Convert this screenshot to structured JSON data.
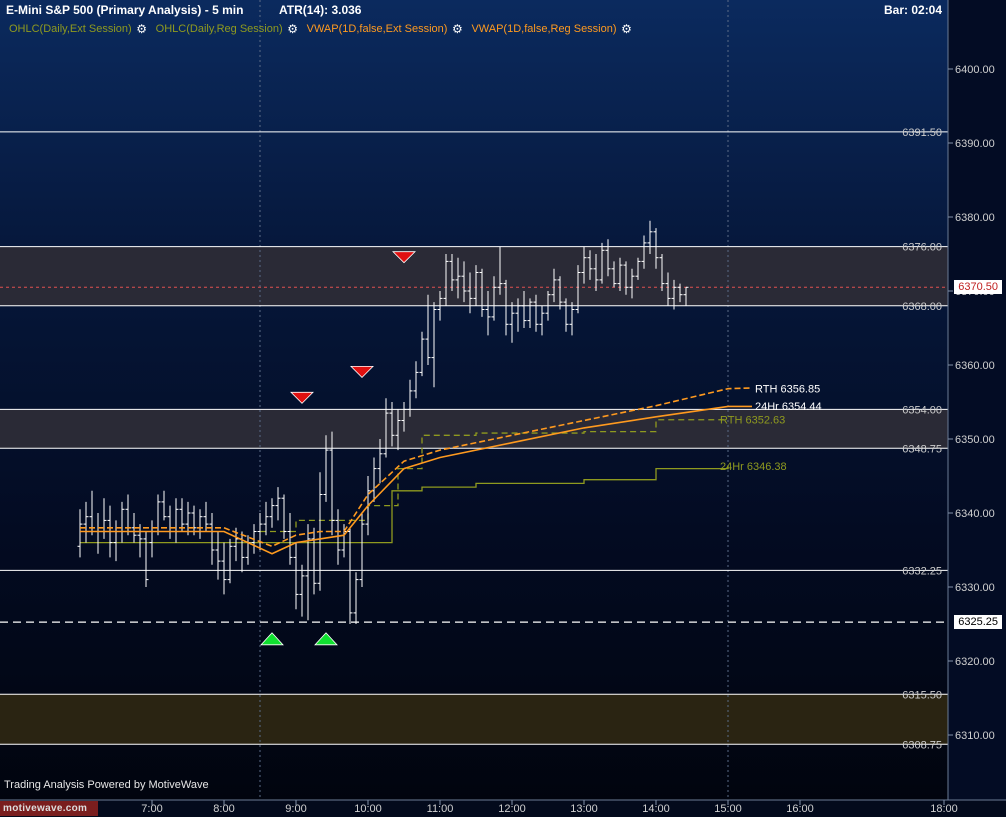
{
  "header": {
    "title": "E-Mini S&P 500 (Primary Analysis) - 5 min",
    "atr": "ATR(14): 3.036",
    "bar_timer": "Bar: 02:04"
  },
  "legend": [
    {
      "label": "OHLC(Daily,Ext Session)",
      "color": "#8f9a1f"
    },
    {
      "label": "OHLC(Daily,Reg Session)",
      "color": "#8f9a1f"
    },
    {
      "label": "VWAP(1D,false,Ext Session)",
      "color": "#ff9a1f"
    },
    {
      "label": "VWAP(1D,false,Reg Session)",
      "color": "#ff9a1f"
    }
  ],
  "icons": {
    "settings": "gear-icon"
  },
  "footer": {
    "powered_by": "Trading Analysis Powered by MotiveWave",
    "logo": "motivewave.com"
  },
  "current_price": {
    "label": "6370.50",
    "value": 6370.5,
    "color": "#ff9a9a"
  },
  "marked_price": {
    "label": "6325.25",
    "value": 6325.25
  },
  "chart_data": {
    "type": "candlestick",
    "title": "E-Mini S&P 500 (Primary Analysis) - 5 min",
    "ylim": [
      6304,
      6406
    ],
    "y_ticks": [
      {
        "label": "6400.00",
        "value": 6400
      },
      {
        "label": "6390.00",
        "value": 6390
      },
      {
        "label": "6380.00",
        "value": 6380
      },
      {
        "label": "6370.00",
        "value": 6370
      },
      {
        "label": "6360.00",
        "value": 6360
      },
      {
        "label": "6350.00",
        "value": 6350
      },
      {
        "label": "6340.00",
        "value": 6340
      },
      {
        "label": "6330.00",
        "value": 6330
      },
      {
        "label": "6320.00",
        "value": 6320
      },
      {
        "label": "6310.00",
        "value": 6310
      }
    ],
    "x_ticks": [
      "7:00",
      "8:00",
      "9:00",
      "10:00",
      "11:00",
      "12:00",
      "13:00",
      "14:00",
      "15:00",
      "16:00",
      "18:00"
    ],
    "session_separators": [
      "8:30",
      "15:00"
    ],
    "levels": [
      {
        "label": "6391.50",
        "value": 6391.5
      },
      {
        "label": "6376.00",
        "value": 6376
      },
      {
        "label": "6368.00",
        "value": 6368
      },
      {
        "label": "6354.00",
        "value": 6354
      },
      {
        "label": "6348.75",
        "value": 6348.75
      },
      {
        "label": "6332.25",
        "value": 6332.25
      },
      {
        "label": "6315.50",
        "value": 6315.5
      },
      {
        "label": "6308.75",
        "value": 6308.75
      }
    ],
    "zones": [
      {
        "from": 6368,
        "to": 6376,
        "color": "#2a2a36"
      },
      {
        "from": 6348.75,
        "to": 6354,
        "color": "#2a2a36"
      },
      {
        "from": 6308.75,
        "to": 6315.5,
        "color": "#2a2412"
      }
    ],
    "annotations": [
      {
        "label": "RTH 6356.85",
        "value": 6356.85,
        "color": "#ffffff"
      },
      {
        "label": "24Hr 6354.44",
        "value": 6354.44,
        "color": "#ffffff"
      },
      {
        "label": "RTH 6352.63",
        "value": 6352.63,
        "color": "#8f9a1f"
      },
      {
        "label": "24Hr 6346.38",
        "value": 6346.38,
        "color": "#8f9a1f"
      }
    ],
    "signals": [
      {
        "type": "sell",
        "time": "9:05",
        "price": 6355.5
      },
      {
        "type": "sell",
        "time": "9:55",
        "price": 6359.0
      },
      {
        "type": "sell",
        "time": "10:30",
        "price": 6374.5
      },
      {
        "type": "buy",
        "time": "8:40",
        "price": 6323.0
      },
      {
        "type": "buy",
        "time": "9:25",
        "price": 6323.0
      }
    ],
    "candles_start": "6:00",
    "candle_interval_minutes": 5,
    "candles": [
      [
        6335.5,
        6340.5,
        6334.0,
        6338.5
      ],
      [
        6338.5,
        6341.5,
        6336.0,
        6339.5
      ],
      [
        6339.5,
        6343.0,
        6337.0,
        6337.5
      ],
      [
        6337.5,
        6340.0,
        6334.5,
        6338.0
      ],
      [
        6338.0,
        6342.0,
        6336.5,
        6339.0
      ],
      [
        6339.0,
        6341.0,
        6334.0,
        6336.0
      ],
      [
        6336.0,
        6339.0,
        6333.5,
        6337.5
      ],
      [
        6337.5,
        6341.5,
        6336.0,
        6340.5
      ],
      [
        6340.5,
        6342.5,
        6337.0,
        6338.0
      ],
      [
        6338.0,
        6340.0,
        6336.0,
        6337.0
      ],
      [
        6337.0,
        6338.5,
        6334.0,
        6336.5
      ],
      [
        6336.5,
        6337.5,
        6330.0,
        6331.0
      ],
      [
        6336.0,
        6339.0,
        6334.0,
        6338.0
      ],
      [
        6338.0,
        6342.5,
        6337.0,
        6341.5
      ],
      [
        6341.5,
        6343.0,
        6339.0,
        6339.5
      ],
      [
        6339.5,
        6341.0,
        6336.5,
        6337.5
      ],
      [
        6337.5,
        6342.0,
        6336.0,
        6340.5
      ],
      [
        6340.5,
        6342.0,
        6337.5,
        6338.5
      ],
      [
        6338.5,
        6341.5,
        6337.0,
        6340.0
      ],
      [
        6340.0,
        6341.0,
        6337.0,
        6338.0
      ],
      [
        6338.0,
        6340.5,
        6336.5,
        6339.5
      ],
      [
        6339.5,
        6341.5,
        6337.5,
        6338.5
      ],
      [
        6338.5,
        6340.0,
        6333.0,
        6335.0
      ],
      [
        6335.0,
        6337.5,
        6331.0,
        6333.5
      ],
      [
        6333.5,
        6336.0,
        6329.0,
        6331.0
      ],
      [
        6331.0,
        6336.5,
        6330.5,
        6335.5
      ],
      [
        6335.5,
        6338.0,
        6333.5,
        6336.5
      ],
      [
        6336.5,
        6337.5,
        6332.0,
        6334.0
      ],
      [
        6334.0,
        6337.0,
        6333.0,
        6336.0
      ],
      [
        6336.0,
        6338.5,
        6334.5,
        6337.5
      ],
      [
        6337.5,
        6340.0,
        6335.0,
        6338.5
      ],
      [
        6338.5,
        6341.5,
        6337.0,
        6339.5
      ],
      [
        6339.5,
        6342.0,
        6338.0,
        6341.0
      ],
      [
        6341.0,
        6343.5,
        6339.0,
        6342.0
      ],
      [
        6342.0,
        6342.5,
        6336.5,
        6337.5
      ],
      [
        6337.5,
        6340.0,
        6333.0,
        6334.0
      ],
      [
        6334.0,
        6336.0,
        6327.0,
        6329.0
      ],
      [
        6329.0,
        6333.0,
        6326.0,
        6331.5
      ],
      [
        6331.5,
        6338.5,
        6325.5,
        6336.5
      ],
      [
        6336.5,
        6338.0,
        6329.0,
        6330.5
      ],
      [
        6330.5,
        6345.5,
        6329.5,
        6342.5
      ],
      [
        6342.5,
        6350.5,
        6341.5,
        6348.5
      ],
      [
        6348.5,
        6351.0,
        6337.0,
        6339.0
      ],
      [
        6339.0,
        6340.5,
        6333.0,
        6335.0
      ],
      [
        6335.0,
        6338.5,
        6334.0,
        6337.5
      ],
      [
        6337.5,
        6338.0,
        6325.0,
        6326.5
      ],
      [
        6326.5,
        6332.0,
        6325.0,
        6331.0
      ],
      [
        6331.0,
        6340.0,
        6330.0,
        6338.5
      ],
      [
        6338.5,
        6345.0,
        6337.0,
        6343.0
      ],
      [
        6343.0,
        6347.5,
        6341.5,
        6346.0
      ],
      [
        6346.0,
        6350.0,
        6344.0,
        6348.0
      ],
      [
        6348.0,
        6355.5,
        6347.5,
        6353.5
      ],
      [
        6353.5,
        6355.0,
        6349.0,
        6350.5
      ],
      [
        6350.5,
        6354.0,
        6348.5,
        6352.5
      ],
      [
        6352.5,
        6355.0,
        6351.0,
        6354.0
      ],
      [
        6354.0,
        6358.0,
        6353.0,
        6356.5
      ],
      [
        6356.5,
        6360.5,
        6355.5,
        6359.0
      ],
      [
        6359.0,
        6364.5,
        6358.5,
        6363.5
      ],
      [
        6363.5,
        6369.5,
        6360.0,
        6361.0
      ],
      [
        6361.0,
        6368.5,
        6357.0,
        6367.5
      ],
      [
        6367.5,
        6370.0,
        6366.0,
        6369.0
      ],
      [
        6369.0,
        6375.0,
        6368.0,
        6374.0
      ],
      [
        6374.0,
        6375.0,
        6370.0,
        6371.5
      ],
      [
        6371.5,
        6374.5,
        6369.0,
        6372.0
      ],
      [
        6372.0,
        6374.0,
        6368.5,
        6370.0
      ],
      [
        6370.0,
        6372.5,
        6367.0,
        6369.0
      ],
      [
        6369.0,
        6373.5,
        6368.0,
        6372.5
      ],
      [
        6372.5,
        6373.0,
        6366.5,
        6367.5
      ],
      [
        6367.5,
        6370.0,
        6364.0,
        6366.5
      ],
      [
        6366.5,
        6372.0,
        6366.0,
        6370.5
      ],
      [
        6370.5,
        6376.0,
        6369.5,
        6371.0
      ],
      [
        6371.0,
        6371.5,
        6364.0,
        6365.5
      ],
      [
        6365.5,
        6368.5,
        6363.0,
        6367.0
      ],
      [
        6367.0,
        6369.0,
        6364.5,
        6368.0
      ],
      [
        6368.0,
        6370.0,
        6365.0,
        6366.0
      ],
      [
        6366.0,
        6369.0,
        6365.0,
        6368.5
      ],
      [
        6368.5,
        6369.5,
        6364.5,
        6365.5
      ],
      [
        6365.5,
        6368.0,
        6364.0,
        6367.0
      ],
      [
        6367.0,
        6370.0,
        6366.0,
        6369.5
      ],
      [
        6369.5,
        6373.0,
        6368.5,
        6371.5
      ],
      [
        6371.5,
        6372.0,
        6367.5,
        6368.5
      ],
      [
        6368.5,
        6369.0,
        6364.5,
        6365.5
      ],
      [
        6365.5,
        6368.5,
        6364.0,
        6367.5
      ],
      [
        6367.5,
        6373.5,
        6367.0,
        6372.5
      ],
      [
        6372.5,
        6376.0,
        6371.0,
        6374.5
      ],
      [
        6374.5,
        6375.5,
        6371.5,
        6373.0
      ],
      [
        6373.0,
        6375.0,
        6370.0,
        6371.5
      ],
      [
        6371.5,
        6376.5,
        6371.0,
        6375.5
      ],
      [
        6375.5,
        6377.0,
        6372.0,
        6373.0
      ],
      [
        6373.0,
        6374.0,
        6370.5,
        6371.0
      ],
      [
        6371.0,
        6374.5,
        6370.0,
        6373.5
      ],
      [
        6373.5,
        6374.0,
        6369.5,
        6370.5
      ],
      [
        6370.5,
        6373.0,
        6369.0,
        6372.0
      ],
      [
        6372.0,
        6374.5,
        6371.5,
        6374.0
      ],
      [
        6374.0,
        6377.5,
        6373.0,
        6376.5
      ],
      [
        6376.5,
        6379.5,
        6375.0,
        6378.0
      ],
      [
        6378.0,
        6378.5,
        6373.0,
        6374.5
      ],
      [
        6374.5,
        6375.0,
        6370.0,
        6371.0
      ],
      [
        6371.0,
        6372.5,
        6368.0,
        6369.0
      ],
      [
        6369.0,
        6371.5,
        6367.5,
        6370.5
      ],
      [
        6370.5,
        6371.0,
        6368.5,
        6369.5
      ],
      [
        6369.5,
        6370.5,
        6368.0,
        6370.5
      ]
    ],
    "series": [
      {
        "name": "VWAP(1D,false,Ext Session)",
        "color": "#ff9a1f",
        "dashed": true,
        "x": [
          "6:00",
          "8:00",
          "8:40",
          "9:00",
          "9:20",
          "9:40",
          "10:00",
          "10:30",
          "11:00",
          "12:00",
          "13:00",
          "14:00",
          "15:00",
          "15:20"
        ],
        "values": [
          6338.0,
          6338.0,
          6335.5,
          6337.0,
          6337.5,
          6337.5,
          6342.5,
          6347.0,
          6348.5,
          6350.5,
          6352.5,
          6354.5,
          6356.8,
          6356.9
        ]
      },
      {
        "name": "VWAP(1D,false,Reg Session)",
        "color": "#ff9a1f",
        "dashed": false,
        "x": [
          "6:00",
          "8:00",
          "8:40",
          "9:00",
          "9:20",
          "9:40",
          "10:00",
          "10:30",
          "11:00",
          "12:00",
          "13:00",
          "14:00",
          "15:00",
          "15:20"
        ],
        "values": [
          6337.5,
          6337.5,
          6334.5,
          6336.0,
          6336.5,
          6337.0,
          6341.0,
          6346.0,
          6347.5,
          6349.5,
          6351.5,
          6353.0,
          6354.4,
          6354.4
        ]
      }
    ],
    "steps": [
      {
        "name": "OHLC(Daily,Reg Session) RTH",
        "color": "#8f9a1f",
        "dashed": true,
        "points": [
          [
            "8:30",
            6337.5
          ],
          [
            "9:00",
            6339.0
          ],
          [
            "9:20",
            6339.0
          ],
          [
            "9:40",
            6339.0
          ],
          [
            "10:00",
            6341.0
          ],
          [
            "10:25",
            6346.0
          ],
          [
            "10:45",
            6350.5
          ],
          [
            "11:30",
            6350.8
          ],
          [
            "13:00",
            6351.0
          ],
          [
            "14:00",
            6352.6
          ],
          [
            "15:00",
            6352.6
          ]
        ]
      },
      {
        "name": "OHLC(Daily,Ext Session) 24Hr",
        "color": "#8f9a1f",
        "dashed": false,
        "points": [
          [
            "6:00",
            6336.0
          ],
          [
            "10:00",
            6336.0
          ],
          [
            "10:20",
            6343.0
          ],
          [
            "10:45",
            6343.5
          ],
          [
            "11:30",
            6344.0
          ],
          [
            "13:00",
            6344.5
          ],
          [
            "14:00",
            6346.0
          ],
          [
            "15:00",
            6346.4
          ]
        ]
      }
    ]
  }
}
